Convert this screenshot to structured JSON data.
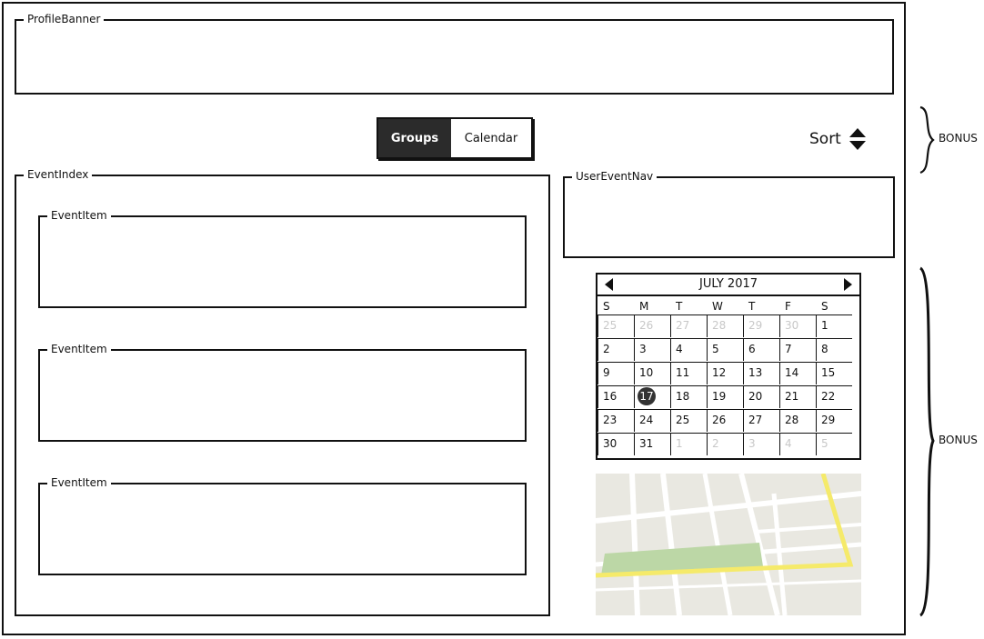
{
  "profile_banner": {
    "label": "ProfileBanner"
  },
  "tabs": [
    {
      "label": "Groups",
      "active": true
    },
    {
      "label": "Calendar",
      "active": false
    }
  ],
  "sort": {
    "label": "Sort",
    "icon": "sort-updown-icon"
  },
  "bonus_labels": {
    "top": "BONUS",
    "right": "BONUS"
  },
  "event_index": {
    "label": "EventIndex",
    "items": [
      {
        "label": "EventItem"
      },
      {
        "label": "EventItem"
      },
      {
        "label": "EventItem"
      }
    ]
  },
  "user_event_nav": {
    "label": "UserEventNav"
  },
  "calendar": {
    "title": "JULY 2017",
    "prev_icon": "triangle-left-icon",
    "next_icon": "triangle-right-icon",
    "weekdays": [
      "S",
      "M",
      "T",
      "W",
      "T",
      "F",
      "S"
    ],
    "selected": "17",
    "weeks": [
      [
        {
          "d": "25",
          "m": true
        },
        {
          "d": "26",
          "m": true
        },
        {
          "d": "27",
          "m": true
        },
        {
          "d": "28",
          "m": true
        },
        {
          "d": "29",
          "m": true
        },
        {
          "d": "30",
          "m": true
        },
        {
          "d": "1",
          "m": false
        }
      ],
      [
        {
          "d": "2",
          "m": false
        },
        {
          "d": "3",
          "m": false
        },
        {
          "d": "4",
          "m": false
        },
        {
          "d": "5",
          "m": false
        },
        {
          "d": "6",
          "m": false
        },
        {
          "d": "7",
          "m": false
        },
        {
          "d": "8",
          "m": false
        }
      ],
      [
        {
          "d": "9",
          "m": false
        },
        {
          "d": "10",
          "m": false
        },
        {
          "d": "11",
          "m": false
        },
        {
          "d": "12",
          "m": false
        },
        {
          "d": "13",
          "m": false
        },
        {
          "d": "14",
          "m": false
        },
        {
          "d": "15",
          "m": false
        }
      ],
      [
        {
          "d": "16",
          "m": false
        },
        {
          "d": "17",
          "m": false
        },
        {
          "d": "18",
          "m": false
        },
        {
          "d": "19",
          "m": false
        },
        {
          "d": "20",
          "m": false
        },
        {
          "d": "21",
          "m": false
        },
        {
          "d": "22",
          "m": false
        }
      ],
      [
        {
          "d": "23",
          "m": false
        },
        {
          "d": "24",
          "m": false
        },
        {
          "d": "25",
          "m": false
        },
        {
          "d": "26",
          "m": false
        },
        {
          "d": "27",
          "m": false
        },
        {
          "d": "28",
          "m": false
        },
        {
          "d": "29",
          "m": false
        }
      ],
      [
        {
          "d": "30",
          "m": false
        },
        {
          "d": "31",
          "m": false
        },
        {
          "d": "1",
          "m": true
        },
        {
          "d": "2",
          "m": true
        },
        {
          "d": "3",
          "m": true
        },
        {
          "d": "4",
          "m": true
        },
        {
          "d": "5",
          "m": true
        }
      ]
    ]
  },
  "map": {
    "icon": "map-placeholder-icon"
  },
  "colors": {
    "dark": "#2b2b2b",
    "road": "#ffffff",
    "highway": "#f5ea6a",
    "park": "#bcd7a6",
    "land": "#e9e8e1"
  }
}
